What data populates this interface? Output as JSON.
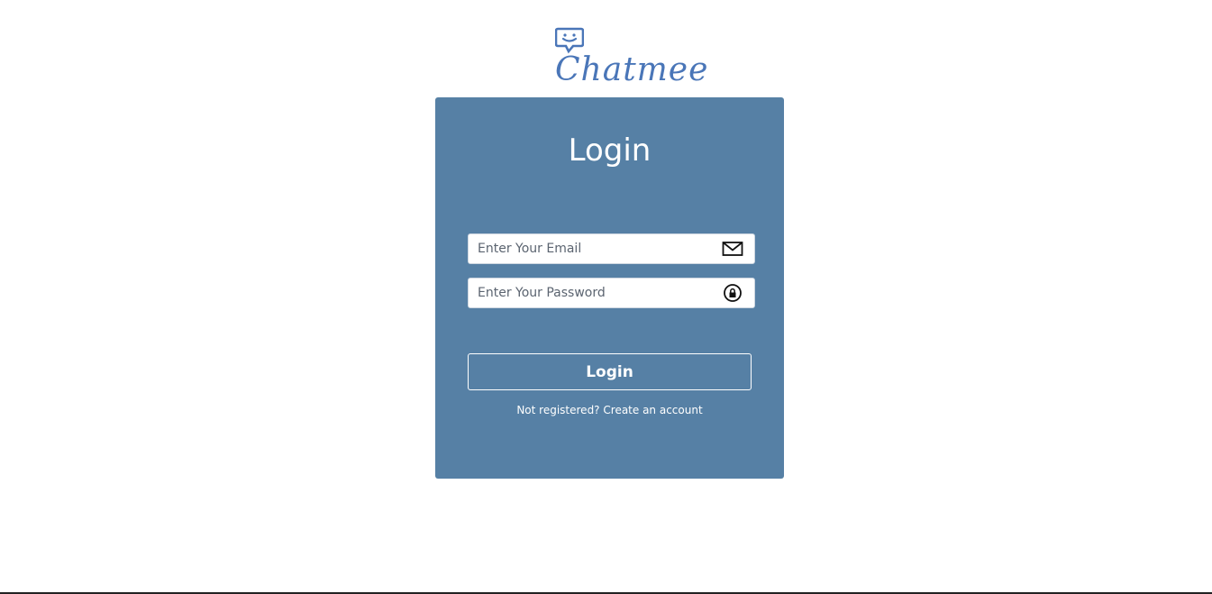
{
  "brand": {
    "name": "Chatmee",
    "color": "#4a76b8"
  },
  "login_card": {
    "title": "Login",
    "background": "#5680a5",
    "email": {
      "placeholder": "Enter Your Email",
      "value": "",
      "icon": "mail-icon"
    },
    "password": {
      "placeholder": "Enter Your Password",
      "value": "",
      "icon": "lock-icon"
    },
    "submit_label": "Login",
    "register_prompt": "Not registered?",
    "register_link": "Create an account"
  }
}
